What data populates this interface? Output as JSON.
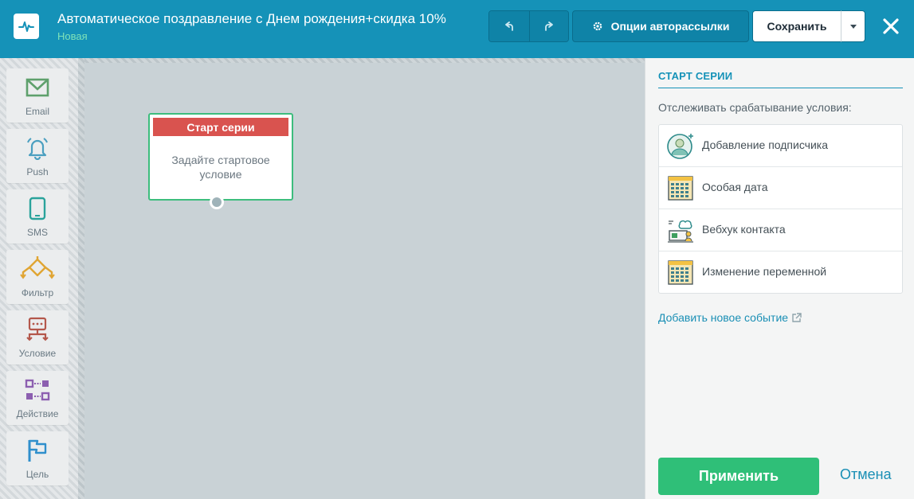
{
  "header": {
    "title": "Автоматическое поздравление с Днем рождения+скидка 10%",
    "status": "Новая",
    "options_label": "Опции авторассылки",
    "save_label": "Сохранить",
    "logo_icon": "pulse-icon",
    "colors": {
      "background": "#1592b8",
      "status": "#7fe3b8"
    }
  },
  "toolbar": {
    "items": [
      {
        "label": "Email",
        "icon": "envelope-icon",
        "color": "#5ea06c"
      },
      {
        "label": "Push",
        "icon": "bell-icon",
        "color": "#4a9fc0"
      },
      {
        "label": "SMS",
        "icon": "phone-icon",
        "color": "#2aa39b"
      },
      {
        "label": "Фильтр",
        "icon": "filter-icon",
        "color": "#e0a533"
      },
      {
        "label": "Условие",
        "icon": "condition-icon",
        "color": "#b4574b"
      },
      {
        "label": "Действие",
        "icon": "action-icon",
        "color": "#8c5fb0"
      },
      {
        "label": "Цель",
        "icon": "flag-icon",
        "color": "#2f8fcc"
      }
    ]
  },
  "canvas": {
    "node": {
      "header": "Старт серии",
      "body_line1": "Задайте стартовое",
      "body_line2": "условие",
      "colors": {
        "header": "#d9534f",
        "border": "#3dbd7d"
      }
    }
  },
  "panel": {
    "title": "СТАРТ СЕРИИ",
    "label": "Отслеживать срабатывание условия:",
    "events": [
      {
        "label": "Добавление подписчика",
        "icon": "add-subscriber-icon"
      },
      {
        "label": "Особая дата",
        "icon": "calendar-icon"
      },
      {
        "label": "Вебхук контакта",
        "icon": "webhook-icon"
      },
      {
        "label": "Изменение переменной",
        "icon": "calendar-icon"
      }
    ],
    "add_event": "Добавить новое событие",
    "apply": "Применить",
    "cancel": "Отмена",
    "colors": {
      "accent": "#1592b8",
      "apply": "#2fbf78"
    }
  }
}
